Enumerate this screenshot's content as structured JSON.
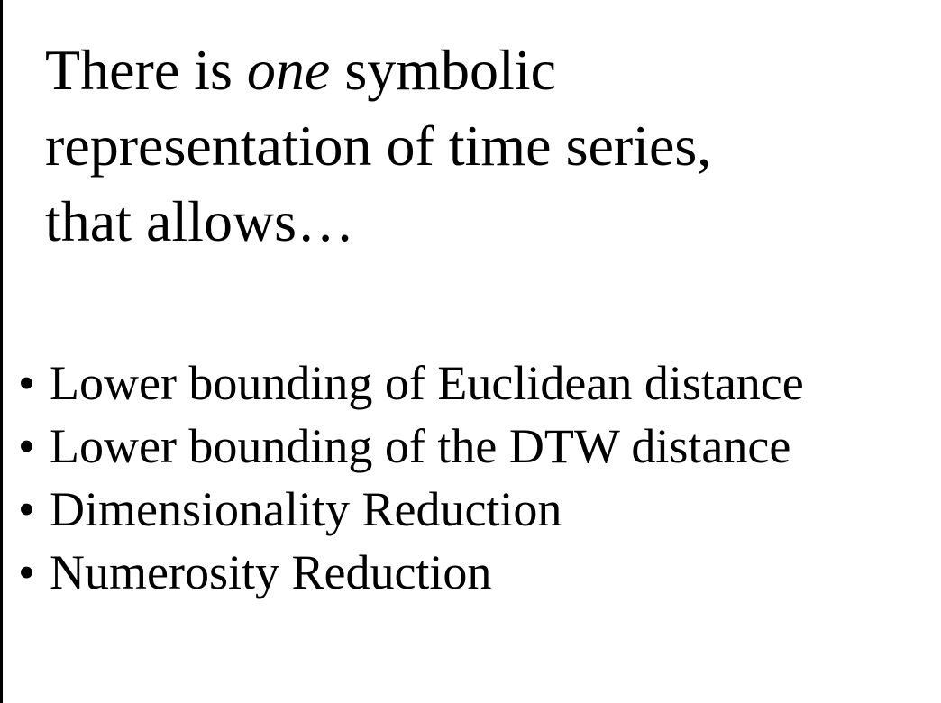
{
  "heading": {
    "line1_before": "There is ",
    "line1_emphasis": "one",
    "line1_after": " symbolic",
    "line2": "representation of time series,",
    "line3": "that allows…"
  },
  "bullets": {
    "marker": "•",
    "items": [
      "Lower bounding of Euclidean distance",
      "Lower bounding of the DTW distance",
      "Dimensionality Reduction",
      "Numerosity Reduction"
    ]
  }
}
